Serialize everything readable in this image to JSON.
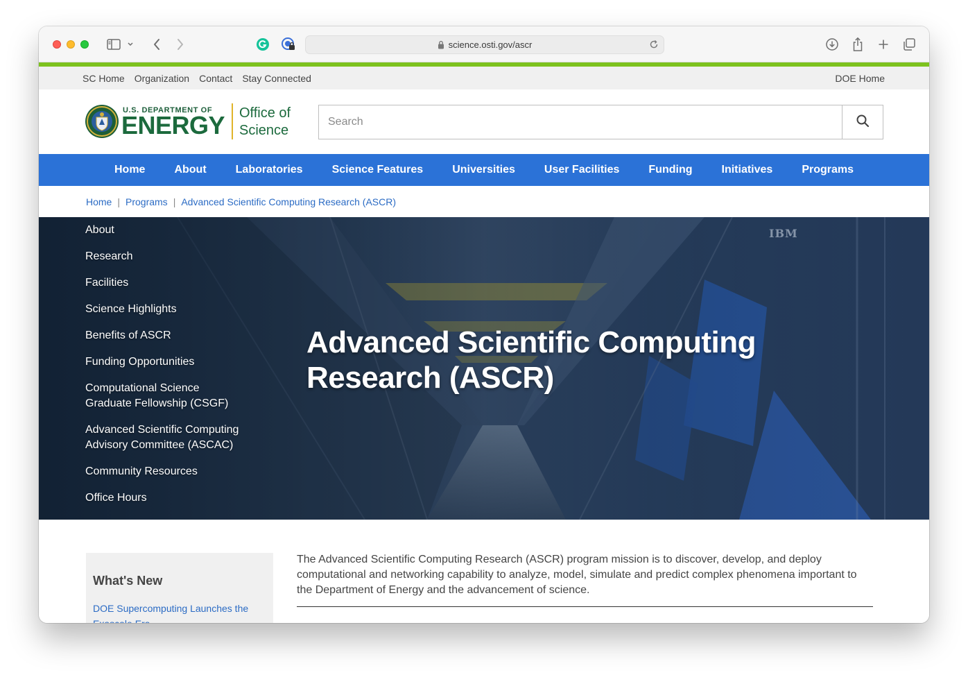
{
  "browser": {
    "url": "science.osti.gov/ascr",
    "icons": [
      "sidebar-icon",
      "chevron-down-icon",
      "back-icon",
      "forward-icon",
      "grammarly-icon",
      "password-icon",
      "lock-icon",
      "reload-icon",
      "download-icon",
      "share-icon",
      "new-tab-icon",
      "tabs-overview-icon"
    ]
  },
  "utility": {
    "links": [
      "SC Home",
      "Organization",
      "Contact",
      "Stay Connected"
    ],
    "doe_home": "DOE Home"
  },
  "logo": {
    "dept": "U.S. DEPARTMENT OF",
    "energy": "ENERGY",
    "office_line1": "Office of",
    "office_line2": "Science"
  },
  "search": {
    "placeholder": "Search"
  },
  "nav": [
    "Home",
    "About",
    "Laboratories",
    "Science Features",
    "Universities",
    "User Facilities",
    "Funding",
    "Initiatives",
    "Programs"
  ],
  "breadcrumb": [
    "Home",
    "Programs",
    "Advanced Scientific Computing Research (ASCR)"
  ],
  "sidemenu": [
    "About",
    "Research",
    "Facilities",
    "Science Highlights",
    "Benefits of ASCR",
    "Funding Opportunities",
    "Computational Science Graduate Fellowship (CSGF)",
    "Advanced Scientific Computing Advisory Committee (ASCAC)",
    "Community Resources",
    "Office Hours"
  ],
  "hero": {
    "title_line1": "Advanced Scientific Computing",
    "title_line2": "Research (ASCR)",
    "ibm_text": "IBM"
  },
  "whats_new": {
    "heading": "What's New",
    "link": "DOE Supercomputing Launches the Exascale Era"
  },
  "mission": "The Advanced Scientific Computing Research (ASCR) program mission is to discover, develop, and deploy computational and networking capability to analyze, model, simulate and predict complex phenomena important to the Department of Energy and the advancement of science.",
  "colors": {
    "nav_blue": "#2b72d7",
    "accent_green": "#7dc21e",
    "doe_green": "#1c6a3d",
    "link_blue": "#2b6bc4"
  }
}
